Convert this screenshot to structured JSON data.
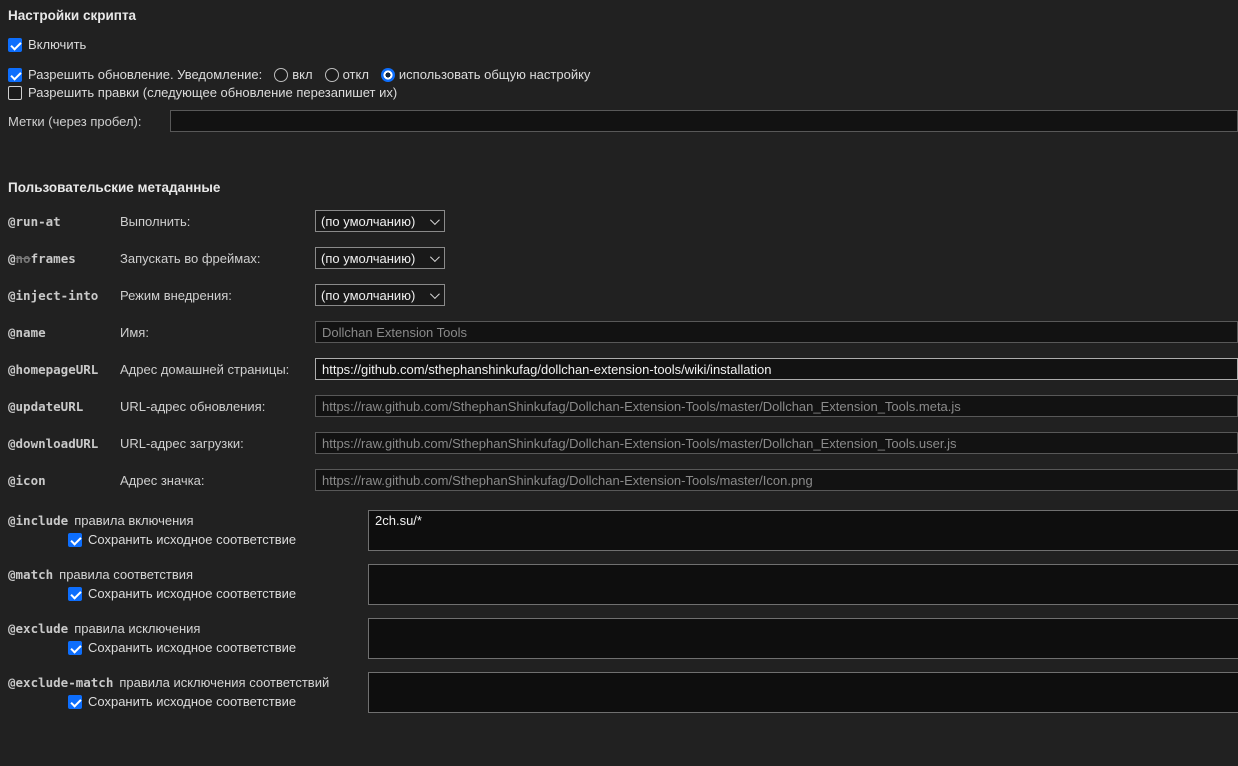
{
  "colors": {
    "accent_blue": "#0d6efd",
    "page_background": "#212121",
    "field_background": "#121212"
  },
  "script_settings": {
    "title": "Настройки скрипта",
    "enable": {
      "label": "Включить",
      "checked": true
    },
    "update": {
      "label": "Разрешить обновление. Уведомление:",
      "checked": true
    },
    "notification": {
      "options": [
        {
          "label": "вкл",
          "selected": false
        },
        {
          "label": "откл",
          "selected": false
        },
        {
          "label": "использовать общую настройку",
          "selected": true
        }
      ]
    },
    "allow_edits": {
      "label": "Разрешить правки (следующее обновление перезапишет их)",
      "checked": false
    },
    "tags": {
      "label": "Метки (через пробел):",
      "value": ""
    }
  },
  "custom_metadata": {
    "title": "Пользовательские метаданные",
    "select_fields": [
      {
        "key": "@run-at",
        "label": "Выполнить:",
        "value": "(по умолчанию)"
      },
      {
        "key_pre": "@",
        "key_strike": "no",
        "key_post": "frames",
        "label": "Запускать во фреймах:",
        "value": "(по умолчанию)"
      },
      {
        "key": "@inject-into",
        "label": "Режим внедрения:",
        "value": "(по умолчанию)"
      }
    ],
    "text_fields": [
      {
        "key": "@name",
        "label": "Имя:",
        "placeholder": "Dollchan Extension Tools",
        "value": ""
      },
      {
        "key": "@homepageURL",
        "label": "Адрес домашней страницы:",
        "placeholder": "",
        "value": "https://github.com/sthephanshinkufag/dollchan-extension-tools/wiki/installation"
      },
      {
        "key": "@updateURL",
        "label": "URL-адрес обновления:",
        "placeholder": "https://raw.github.com/SthephanShinkufag/Dollchan-Extension-Tools/master/Dollchan_Extension_Tools.meta.js",
        "value": ""
      },
      {
        "key": "@downloadURL",
        "label": "URL-адрес загрузки:",
        "placeholder": "https://raw.github.com/SthephanShinkufag/Dollchan-Extension-Tools/master/Dollchan_Extension_Tools.user.js",
        "value": ""
      },
      {
        "key": "@icon",
        "label": "Адрес значка:",
        "placeholder": "https://raw.github.com/SthephanShinkufag/Dollchan-Extension-Tools/master/Icon.png",
        "value": ""
      }
    ],
    "rule_fields": [
      {
        "key": "@include",
        "label": "правила включения",
        "keep_label": "Сохранить исходное соответствие",
        "keep_checked": true,
        "value": "2ch.su/*"
      },
      {
        "key": "@match",
        "label": "правила соответствия",
        "keep_label": "Сохранить исходное соответствие",
        "keep_checked": true,
        "value": ""
      },
      {
        "key": "@exclude",
        "label": "правила исключения",
        "keep_label": "Сохранить исходное соответствие",
        "keep_checked": true,
        "value": ""
      },
      {
        "key": "@exclude-match",
        "label": "правила исключения соответствий",
        "keep_label": "Сохранить исходное соответствие",
        "keep_checked": true,
        "value": ""
      }
    ]
  }
}
